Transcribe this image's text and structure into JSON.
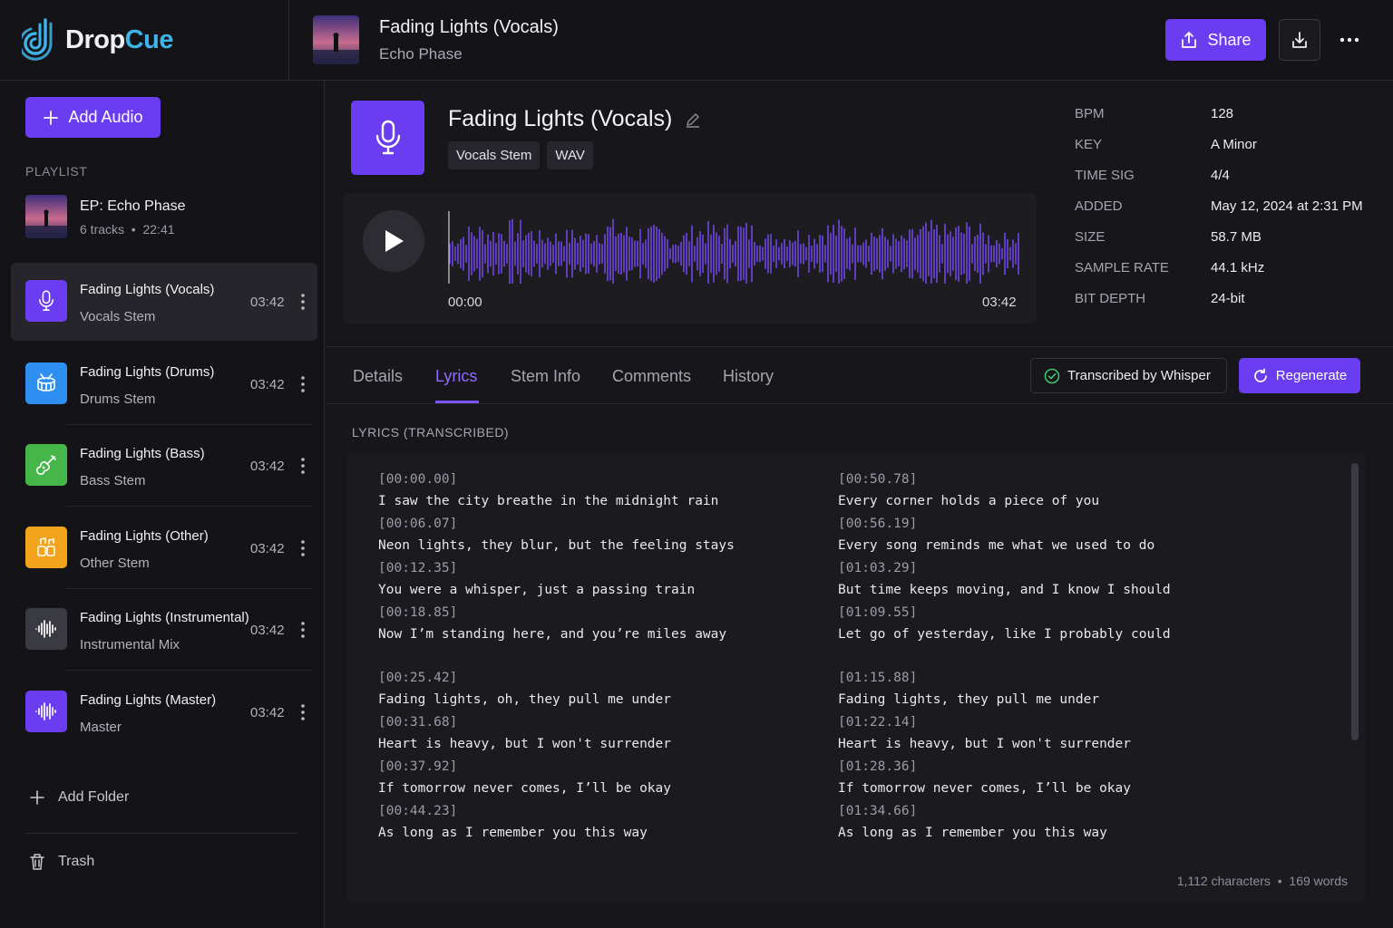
{
  "brand": {
    "part1": "Drop",
    "part2": "Cue",
    "accent": "#6a3df0",
    "logo_color": "#3fb4e8"
  },
  "now_playing": {
    "title": "Fading Lights (Vocals)",
    "subtitle": "Echo Phase"
  },
  "actions": {
    "share_label": "Share",
    "download_icon": "download-icon",
    "more_icon": "more-horizontal-icon"
  },
  "sidebar": {
    "add_audio_label": "Add Audio",
    "playlist_label": "PLAYLIST",
    "ep": {
      "title": "EP: Echo Phase",
      "tracks": "6 tracks",
      "duration": "22:41"
    },
    "tracks": [
      {
        "name": "Fading Lights (Vocals)",
        "sub": "Vocals Stem",
        "time": "03:42",
        "icon": "microphone-icon",
        "color": "#6a3df0"
      },
      {
        "name": "Fading Lights (Drums)",
        "sub": "Drums Stem",
        "time": "03:42",
        "icon": "drum-icon",
        "color": "#2f8ef2"
      },
      {
        "name": "Fading Lights (Bass)",
        "sub": "Bass Stem",
        "time": "03:42",
        "icon": "guitar-icon",
        "color": "#46b64a"
      },
      {
        "name": "Fading Lights (Other)",
        "sub": "Other Stem",
        "time": "03:42",
        "icon": "music-cells-icon",
        "color": "#f2a51c"
      },
      {
        "name": "Fading Lights (Instrumental)",
        "sub": "Instrumental Mix",
        "time": "03:42",
        "icon": "waveform-icon",
        "color": "#3a3a42"
      },
      {
        "name": "Fading Lights (Master)",
        "sub": "Master",
        "time": "03:42",
        "icon": "waveform-icon",
        "color": "#6a3df0"
      }
    ],
    "add_folder_label": "Add Folder",
    "trash_label": "Trash"
  },
  "track": {
    "title": "Fading Lights (Vocals)",
    "tags": [
      "Vocals Stem",
      "WAV"
    ],
    "time_start": "00:00",
    "time_end": "03:42",
    "wave_color": "#7b4dff"
  },
  "meta": [
    {
      "key": "BPM",
      "value": "128"
    },
    {
      "key": "KEY",
      "value": "A Minor"
    },
    {
      "key": "TIME SIG",
      "value": "4/4"
    },
    {
      "key": "ADDED",
      "value": "May 12, 2024 at 2:31 PM"
    },
    {
      "key": "SIZE",
      "value": "58.7 MB"
    },
    {
      "key": "SAMPLE RATE",
      "value": "44.1 kHz"
    },
    {
      "key": "BIT DEPTH",
      "value": "24-bit"
    }
  ],
  "tabs": [
    {
      "label": "Details",
      "active": false
    },
    {
      "label": "Lyrics",
      "active": true
    },
    {
      "label": "Stem Info",
      "active": false
    },
    {
      "label": "Comments",
      "active": false
    },
    {
      "label": "History",
      "active": false
    }
  ],
  "transcribed_label": "Transcribed by Whisper",
  "regenerate_label": "Regenerate",
  "lyrics": {
    "label": "LYRICS (TRANSCRIBED)",
    "left": [
      {
        "ts": "[00:00.00]",
        "line": "I saw the city breathe in the midnight rain"
      },
      {
        "ts": "[00:06.07]",
        "line": "Neon lights, they blur, but the feeling stays"
      },
      {
        "ts": "[00:12.35]",
        "line": "You were a whisper, just a passing train"
      },
      {
        "ts": "[00:18.85]",
        "line": "Now I’m standing here, and you’re miles away"
      },
      {
        "gap": true
      },
      {
        "ts": "[00:25.42]",
        "line": "Fading lights, oh, they pull me under"
      },
      {
        "ts": "[00:31.68]",
        "line": "Heart is heavy, but I won't surrender"
      },
      {
        "ts": "[00:37.92]",
        "line": "If tomorrow never comes, I’ll be okay"
      },
      {
        "ts": "[00:44.23]",
        "line": "As long as I remember you this way"
      }
    ],
    "right": [
      {
        "ts": "[00:50.78]",
        "line": "Every corner holds a piece of you"
      },
      {
        "ts": "[00:56.19]",
        "line": "Every song reminds me what we used to do"
      },
      {
        "ts": "[01:03.29]",
        "line": "But time keeps moving, and I know I should"
      },
      {
        "ts": "[01:09.55]",
        "line": "Let go of yesterday, like I probably could"
      },
      {
        "gap": true
      },
      {
        "ts": "[01:15.88]",
        "line": "Fading lights, they pull me under"
      },
      {
        "ts": "[01:22.14]",
        "line": "Heart is heavy, but I won't surrender"
      },
      {
        "ts": "[01:28.36]",
        "line": "If tomorrow never comes, I’ll be okay"
      },
      {
        "ts": "[01:34.66]",
        "line": "As long as I remember you this way"
      }
    ],
    "chars": "1,112 characters",
    "words": "169 words"
  }
}
